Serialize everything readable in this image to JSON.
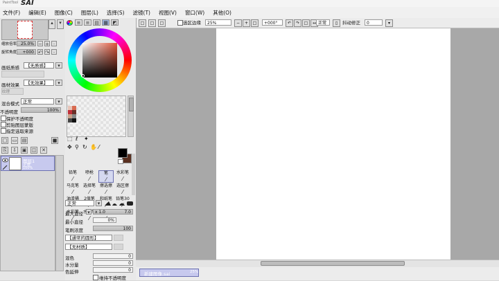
{
  "app": {
    "logo_small": "PaintTool",
    "logo_big": "SAI"
  },
  "menu": [
    "文件(F)",
    "编辑(E)",
    "图像(C)",
    "图层(L)",
    "选择(S)",
    "滤镜(T)",
    "视图(V)",
    "窗口(W)",
    "其他(O)"
  ],
  "toolbar": {
    "stabilizer_check_label": "选区边缘",
    "zoom_value": "25%",
    "rotate_value": "+000°",
    "blend_value": "正常",
    "shake_label": "抖动修正",
    "shake_value": "0"
  },
  "navigator": {
    "zoom_label": "缩放倍率",
    "zoom_value": "25.0%",
    "angle_label": "旋转角度",
    "angle_value": "+000"
  },
  "paper": {
    "texture_label": "画纸质感",
    "texture_value": "【无质感】",
    "effect_label": "画材效果",
    "effect_value": "【无效果】",
    "effect_sub": "纹理"
  },
  "layer_props": {
    "mode_label": "混合模式",
    "mode_value": "正常",
    "opacity_label": "不透明度",
    "opacity_value": "100%",
    "options": [
      "保护不透明度",
      "剪贴图层蒙版",
      "指定选取来源"
    ]
  },
  "layers": [
    {
      "name": "图层1",
      "mode": "正常",
      "opacity": "100%"
    }
  ],
  "tools": [
    {
      "label": "铅笔",
      "icon": "pencil-icon"
    },
    {
      "label": "喷枪",
      "icon": "airbrush-icon"
    },
    {
      "label": "笔",
      "icon": "brush-icon"
    },
    {
      "label": "水彩笔",
      "icon": "watercolor-icon"
    },
    {
      "label": "马克笔",
      "icon": "marker-icon"
    },
    {
      "label": "选择笔",
      "icon": "select-pen-icon"
    },
    {
      "label": "擦选擦",
      "icon": "select-eraser-icon"
    },
    {
      "label": "选区擦",
      "icon": "eraser-icon"
    },
    {
      "label": "油漆桶",
      "icon": "bucket-icon"
    },
    {
      "label": "2值笔",
      "icon": "binary-pen-icon"
    },
    {
      "label": "和纸笔",
      "icon": "washi-pen-icon"
    },
    {
      "label": "铅笔30",
      "icon": "pencil30-icon"
    },
    {
      "label": "水彩笔",
      "icon": "watercolor2-icon"
    },
    {
      "label": "水彩笔",
      "icon": "watercolor3-icon"
    },
    {
      "label": "铅笔",
      "icon": "pencil2-icon"
    }
  ],
  "brush": {
    "mode_value": "正常",
    "size_label": "最大直径",
    "size_mult": "x 1.0",
    "size_value": "7.0",
    "min_label": "最小直径",
    "min_value": "0%",
    "density_label": "笔刷浓度",
    "density_value": "100",
    "shape_value": "【通常的圆形】",
    "texture_value": "【无材质】",
    "blend_label": "混色",
    "blend_value": "0",
    "water_label": "水分量",
    "water_value": "0",
    "color_extend_label": "色延伸",
    "color_extend_value": "0",
    "keep_opacity_label": "维持不透明度"
  },
  "status": {
    "doc_name": "新建图像.sai",
    "doc_zoom": "25%"
  },
  "colors": {
    "swatches": [
      "#e8c4b8",
      "#d86a50",
      "#c0303a",
      "#6a3028",
      "#c8a088",
      "#888888",
      "#444444",
      "#111111"
    ],
    "foreground": "#000000",
    "background": "#5a3020"
  }
}
